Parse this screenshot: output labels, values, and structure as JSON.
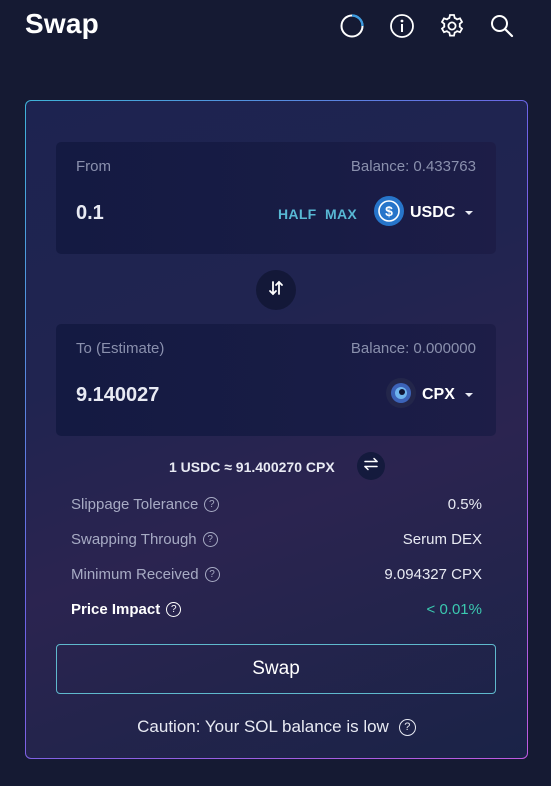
{
  "header": {
    "title": "Swap",
    "icons": [
      "refresh-icon",
      "info-icon",
      "gear-icon",
      "search-icon"
    ]
  },
  "from": {
    "label": "From",
    "balance": "Balance: 0.433763",
    "amount": "0.1",
    "half_label": "HALF",
    "max_label": "MAX",
    "token": "USDC"
  },
  "to": {
    "label": "To (Estimate)",
    "balance": "Balance: 0.000000",
    "amount": "9.140027",
    "token": "CPX"
  },
  "rate": "1 USDC ≈ 91.400270 CPX",
  "details": {
    "slippage_label": "Slippage Tolerance",
    "slippage_value": "0.5%",
    "route_label": "Swapping Through",
    "route_value": "Serum DEX",
    "min_label": "Minimum Received",
    "min_value": "9.094327 CPX",
    "impact_label": "Price Impact",
    "impact_value": "< 0.01%"
  },
  "swap_button": "Swap",
  "caution": "Caution: Your SOL balance is low",
  "colors": {
    "background": "#151a33",
    "accent": "#58b8d4",
    "impact_green": "#3bc9b0",
    "border_gradient": [
      "#3fb3d8",
      "#6d63e6",
      "#c05ae0"
    ]
  }
}
